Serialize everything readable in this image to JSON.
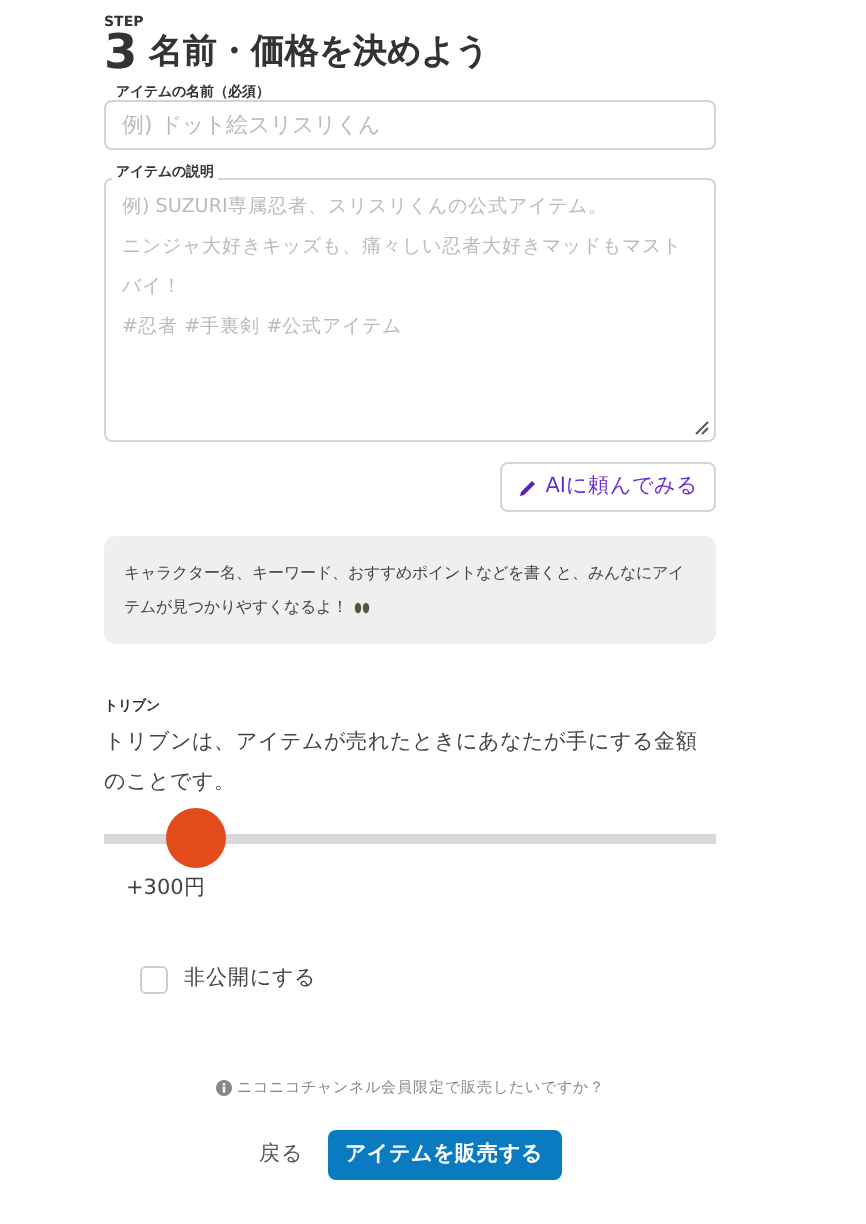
{
  "step": {
    "label": "STEP",
    "number": "3",
    "title": "名前・価格を決めよう"
  },
  "name_field": {
    "label": "アイテムの名前（必須）",
    "placeholder": "例) ドット絵スリスリくん"
  },
  "description_field": {
    "label": "アイテムの説明",
    "placeholder_lines": [
      "例) SUZURI専属忍者、スリスリくんの公式アイテム。",
      "ニンジャ大好きキッズも、痛々しい忍者大好きマッドもマストバイ！",
      "#忍者 #手裏剣 #公式アイテム"
    ]
  },
  "ai_button": {
    "label": "AIに頼んでみる"
  },
  "hint": "キャラクター名、キーワード、おすすめポイントなどを書くと、みんなにアイテムが見つかりやすくなるよ！",
  "royalty": {
    "label": "トリブン",
    "description": "トリブンは、アイテムが売れたときにあなたが手にする金額のことです。",
    "level": 0.1,
    "value": "+300円"
  },
  "private_checkbox": {
    "label": "非公開にする",
    "checked": false
  },
  "channel_link": "ニコニコチャンネル会員限定で販売したいですか？",
  "buttons": {
    "back": "戻る",
    "submit": "アイテムを販売する"
  }
}
